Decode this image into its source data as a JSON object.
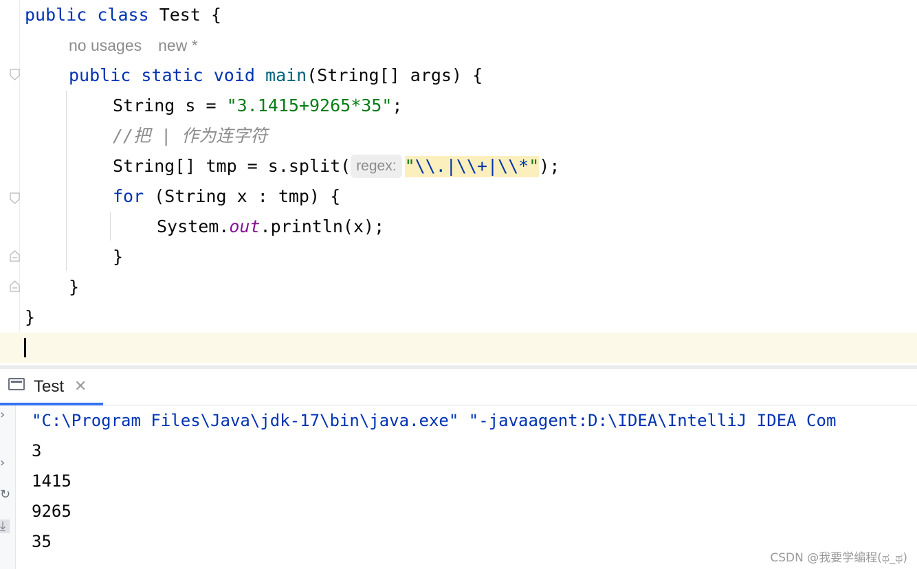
{
  "editor": {
    "lines": {
      "class_decl": {
        "kw1": "public",
        "kw2": "class",
        "name": "Test",
        "brace": "{"
      },
      "usage_hint": {
        "usages": "no usages",
        "author": "new *"
      },
      "main_decl": {
        "kw1": "public",
        "kw2": "static",
        "kw3": "void",
        "name": "main",
        "params": "(String[] args) {"
      },
      "string_decl": {
        "prefix": "String s = ",
        "literal": "\"3.1415+9265*35\"",
        "suffix": ";"
      },
      "comment": "//把 | 作为连字符",
      "split_line": {
        "prefix": "String[] tmp = s.split(",
        "hint": "regex:",
        "quote_open": "\"",
        "regex": "\\\\.|\\\\+|\\\\*",
        "quote_close": "\"",
        "suffix": ");"
      },
      "for_line": {
        "kw": "for",
        "rest": " (String x : tmp) {"
      },
      "println_line": {
        "prefix": "System.",
        "field": "out",
        "suffix": ".println(x);"
      },
      "close_for": "}",
      "close_main": "}",
      "close_class": "}"
    }
  },
  "run_panel": {
    "tab_label": "Test",
    "tab_close": "✕",
    "command": "\"C:\\Program Files\\Java\\jdk-17\\bin\\java.exe\" \"-javaagent:D:\\IDEA\\IntelliJ IDEA Com",
    "output": [
      "3",
      "1415",
      "9265",
      "35"
    ]
  },
  "watermark": "CSDN @我要学编程(ಥ_ಥ)",
  "colors": {
    "keyword": "#0033b3",
    "string": "#067d17",
    "comment": "#8c8c8c",
    "field": "#871094",
    "current_line": "#fcf9e8",
    "regex_highlight": "#fcefbe",
    "tab_underline": "#3574f0"
  },
  "icons": [
    "fold-icon",
    "run-tab-icon",
    "close-icon",
    "side-toolbar-icon"
  ]
}
